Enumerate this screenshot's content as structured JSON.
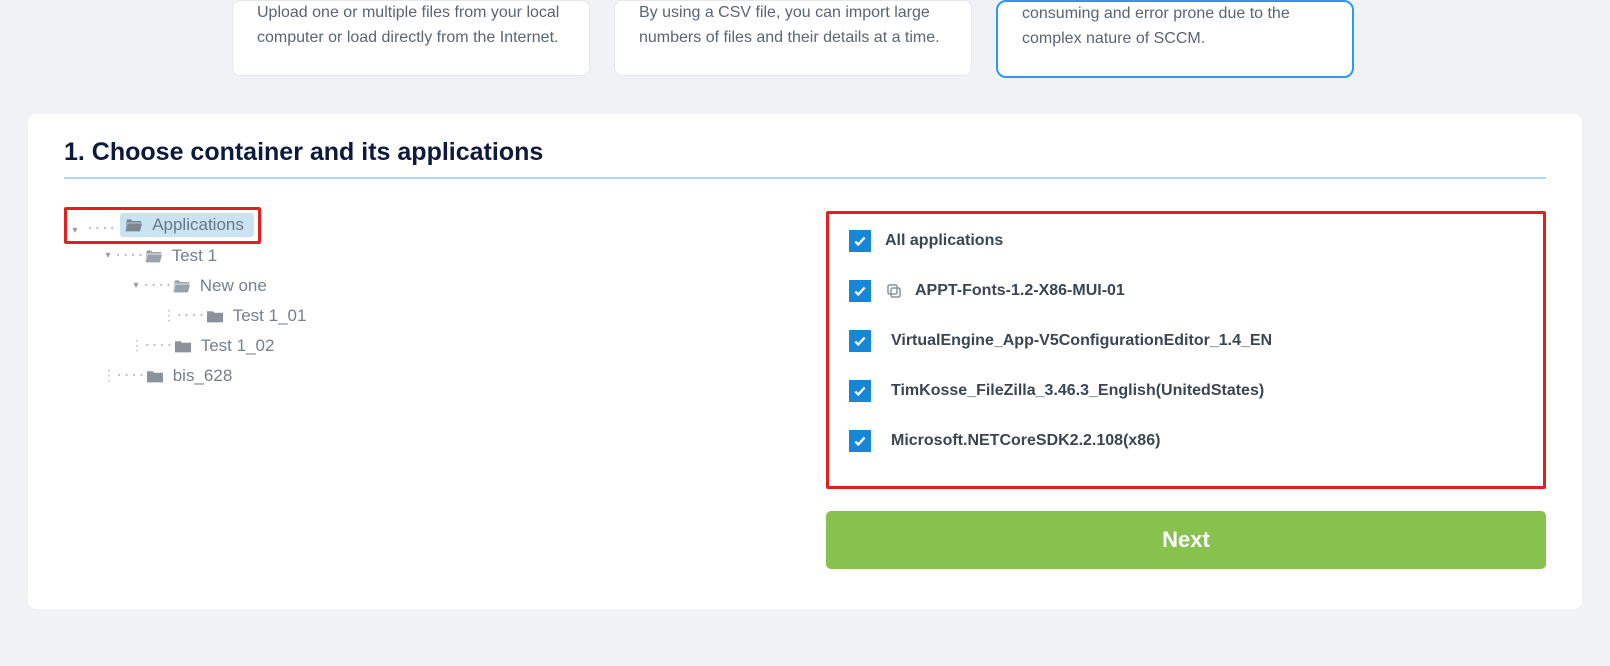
{
  "cards": {
    "upload": "Upload one or multiple files from your local computer or load directly from the Internet.",
    "csv": "By using a CSV file, you can import large numbers of files and their details at a time.",
    "sccm": "consuming and error prone due to the complex nature of SCCM."
  },
  "section": {
    "title": "1. Choose container and its applications"
  },
  "tree": {
    "root": "Applications",
    "nodes": [
      {
        "label": "Test 1",
        "indent": 1,
        "open": true
      },
      {
        "label": "New one",
        "indent": 2,
        "open": true
      },
      {
        "label": "Test 1_01",
        "indent": 3,
        "open": false
      },
      {
        "label": "Test 1_02",
        "indent": 2,
        "folderClosed": true
      },
      {
        "label": "bis_628",
        "indent": 1,
        "folderClosed": true
      }
    ]
  },
  "apps": {
    "all_label": "All applications",
    "items": [
      "APPT-Fonts-1.2-X86-MUI-01",
      "VirtualEngine_App-V5ConfigurationEditor_1.4_EN",
      "TimKosse_FileZilla_3.46.3_English(UnitedStates)",
      "Microsoft.NETCoreSDK2.2.108(x86)"
    ]
  },
  "buttons": {
    "next": "Next"
  }
}
